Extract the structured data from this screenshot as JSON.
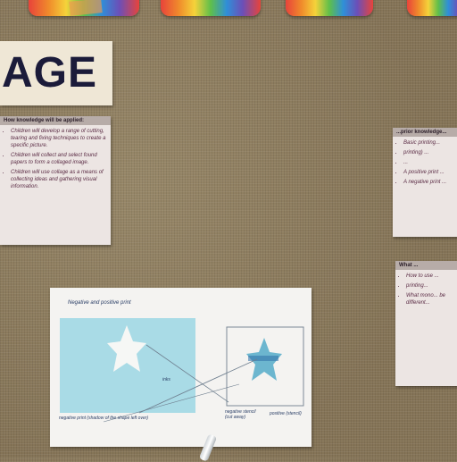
{
  "heading": {
    "text": "AGE"
  },
  "left_card": {
    "header": "How knowledge will be applied:",
    "items": [
      "Children will develop a range of cutting, tearing and fixing techniques to create a specific picture.",
      "Children will collect and select found papers to form a collaged image.",
      "Children will use collage as a means of collecting ideas and gathering visual information."
    ]
  },
  "right_card_top": {
    "header": "...prior knowledge...",
    "items": [
      "Basic printing...",
      "printing) ...",
      "...",
      "A positive print ...",
      "A negative print ..."
    ]
  },
  "right_card_bottom": {
    "header": "What ...",
    "items": [
      "How to use ...",
      "printing...",
      "What mono... be different..."
    ]
  },
  "diagram": {
    "title": "Negative and positive print",
    "label_center": "inks",
    "label_bottom_left": "negative print (shadow of the shape left over)",
    "label_bottom_mid": "negative stencil (cut away)",
    "label_bottom_right": "positive (stencil)"
  },
  "colors": {
    "burlap": "#8b7c62",
    "card": "#ece5e3",
    "card_header": "#b7aca8",
    "heading_ink": "#1b1b3a",
    "print_blue": "#a9dbe6",
    "star_blue": "#6cb6cf"
  }
}
